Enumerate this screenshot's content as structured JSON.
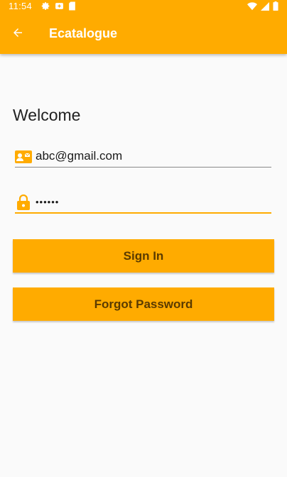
{
  "status_bar": {
    "time": "11:54",
    "icons_left": [
      "settings-icon",
      "notification-icon",
      "sd-card-icon"
    ],
    "icons_right": [
      "wifi-icon",
      "cellular-signal-icon",
      "battery-icon"
    ]
  },
  "toolbar": {
    "back_icon": "arrow-back-icon",
    "title": "Ecatalogue"
  },
  "login": {
    "heading": "Welcome",
    "email": {
      "icon": "contact-card-icon",
      "value": "abc@gmail.com"
    },
    "password": {
      "icon": "lock-icon",
      "value": "••••••"
    },
    "sign_in_label": "Sign In",
    "forgot_password_label": "Forgot Password"
  },
  "colors": {
    "accent": "#ffab00",
    "button_text": "#5a3b00",
    "background": "#fafafa"
  }
}
